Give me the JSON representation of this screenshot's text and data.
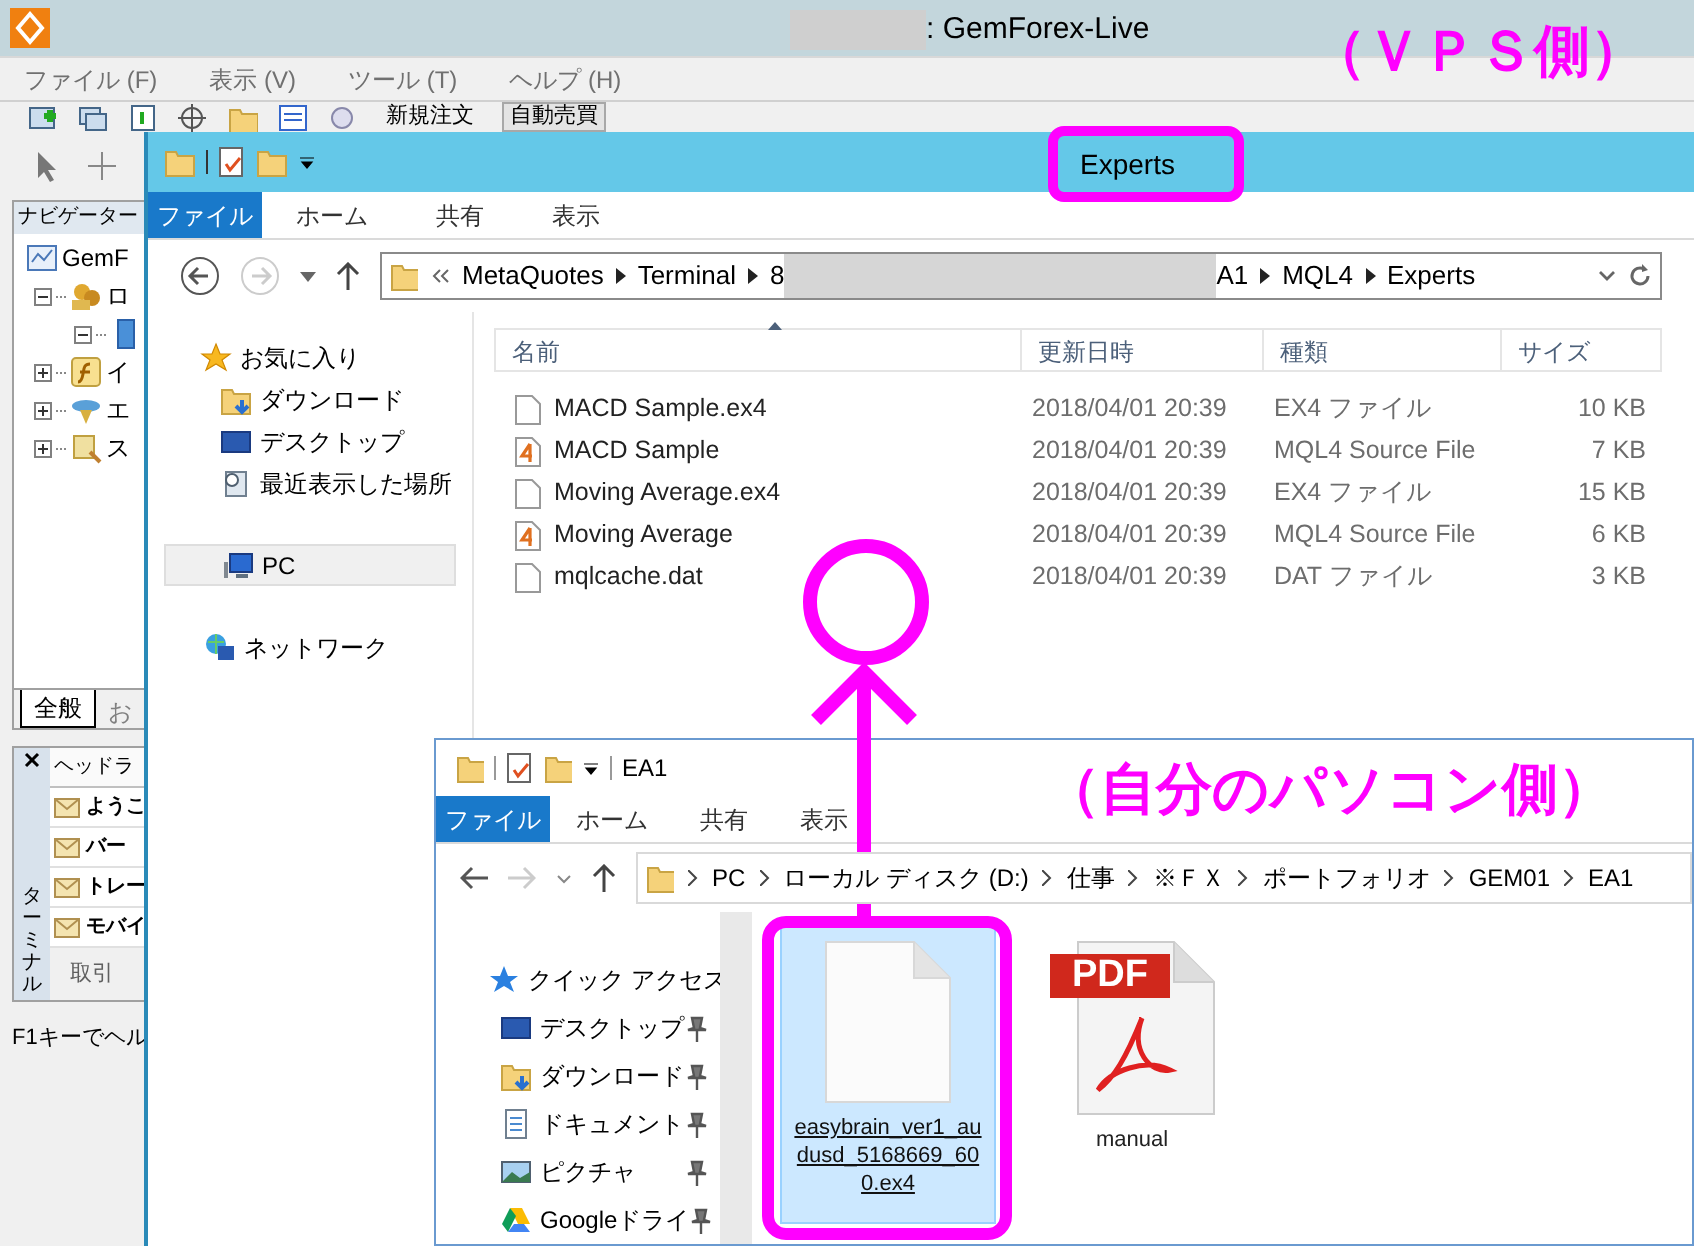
{
  "app": {
    "title": ": GemForex-Live",
    "menu": [
      "ファイル (F)",
      "表示 (V)",
      "ツール (T)",
      "ヘルプ (H)"
    ],
    "toolbar_buttons": [
      {
        "label": "新規注文",
        "pressed": false
      },
      {
        "label": "自動売買",
        "pressed": true
      }
    ],
    "navigator": {
      "title": "ナビゲーター",
      "tree": [
        {
          "label": "GemF",
          "kind": "terminal",
          "children": [
            {
              "label": "ロ",
              "kind": "accounts",
              "expanded": true,
              "children": [
                {
                  "kind": "server",
                  "expanded": true
                }
              ]
            },
            {
              "label": "イ",
              "kind": "indicators",
              "expanded": false
            },
            {
              "label": "エ",
              "kind": "experts",
              "expanded": false
            },
            {
              "label": "ス",
              "kind": "scripts",
              "expanded": false
            }
          ]
        }
      ],
      "tabs": [
        {
          "label": "全般",
          "selected": true
        },
        {
          "label": "お",
          "selected": false
        }
      ]
    },
    "terminal": {
      "side_label": "ターミナル",
      "header": "ヘッドラ",
      "rows": [
        "ようこ",
        "バー",
        "トレー",
        "モバイ"
      ],
      "tabs": [
        "取引"
      ]
    },
    "status_bar": "F1キーでヘル"
  },
  "vps_explorer": {
    "title": "Experts",
    "file_button": "ファイル",
    "tabs": [
      "ホーム",
      "共有",
      "表示"
    ],
    "address": [
      {
        "kind": "text",
        "text": "MetaQuotes"
      },
      {
        "kind": "text",
        "text": "Terminal"
      },
      {
        "kind": "redacted",
        "head": "8",
        "tail": "A1"
      },
      {
        "kind": "text",
        "text": "MQL4"
      },
      {
        "kind": "text",
        "text": "Experts"
      }
    ],
    "nav": [
      {
        "label": "お気に入り",
        "kind": "favorites",
        "selected": false
      },
      {
        "label": "ダウンロード",
        "kind": "downloads",
        "selected": false
      },
      {
        "label": "デスクトップ",
        "kind": "desktop",
        "selected": false
      },
      {
        "label": "最近表示した場所",
        "kind": "recent",
        "selected": false
      },
      {
        "label": "PC",
        "kind": "pc",
        "selected": true
      },
      {
        "label": "ネットワーク",
        "kind": "network",
        "selected": false
      }
    ],
    "columns": [
      "名前",
      "更新日時",
      "種類",
      "サイズ"
    ],
    "rows": [
      {
        "kind": "ex4",
        "name": "MACD Sample.ex4",
        "modified": "2018/04/01 20:39",
        "type": "EX4 ファイル",
        "size": "10 KB"
      },
      {
        "kind": "mq4",
        "name": "MACD Sample",
        "modified": "2018/04/01 20:39",
        "type": "MQL4 Source File",
        "size": "7 KB"
      },
      {
        "kind": "ex4",
        "name": "Moving Average.ex4",
        "modified": "2018/04/01 20:39",
        "type": "EX4 ファイル",
        "size": "15 KB"
      },
      {
        "kind": "mq4",
        "name": "Moving Average",
        "modified": "2018/04/01 20:39",
        "type": "MQL4 Source File",
        "size": "6 KB"
      },
      {
        "kind": "ex4",
        "name": "mqlcache.dat",
        "modified": "2018/04/01 20:39",
        "type": "DAT ファイル",
        "size": "3 KB"
      }
    ]
  },
  "local_explorer": {
    "title": "EA1",
    "file_button": "ファイル",
    "tabs": [
      "ホーム",
      "共有",
      "表示"
    ],
    "address": [
      "PC",
      "ローカル ディスク (D:)",
      "仕事",
      "※ＦＸ",
      "ポートフォリオ",
      "GEM01",
      "EA1"
    ],
    "nav": [
      {
        "label": "クイック アクセス",
        "kind": "quick",
        "pinned": false
      },
      {
        "label": "デスクトップ",
        "kind": "desktop",
        "pinned": true
      },
      {
        "label": "ダウンロード",
        "kind": "downloads",
        "pinned": true
      },
      {
        "label": "ドキュメント",
        "kind": "documents",
        "pinned": true
      },
      {
        "label": "ピクチャ",
        "kind": "pictures",
        "pinned": true
      },
      {
        "label": "Googleドライ",
        "kind": "gdrive",
        "pinned": true
      }
    ],
    "files": [
      {
        "name": "easybrain_ver1_audusd_5168669_600.ex4",
        "kind": "blank",
        "selected": true
      },
      {
        "name": "manual",
        "kind": "pdf",
        "badge": "PDF",
        "selected": false
      }
    ]
  },
  "annotations": {
    "vps_label": "（ＶＰＳ側）",
    "local_label": "（自分のパソコン側）"
  }
}
